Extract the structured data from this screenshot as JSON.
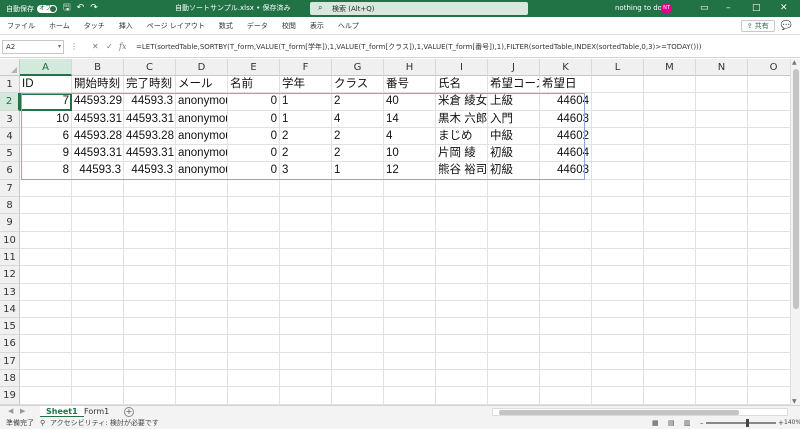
{
  "titlebar": {
    "autosave_label": "自動保存",
    "autosave_state": "オフ",
    "save_icon": "save-icon",
    "undo_icon": "undo-icon",
    "redo_icon": "redo-icon",
    "file_title": "自動ソートサンプル.xlsx • 保存済み",
    "search_placeholder": "検索 (Alt+Q)",
    "user_name": "nothing to do",
    "avatar_initials": "NT",
    "min": "–",
    "max": "□",
    "close": "✕"
  },
  "ribbon": {
    "tabs": [
      "ファイル",
      "ホーム",
      "タッチ",
      "挿入",
      "ページ レイアウト",
      "数式",
      "データ",
      "校閲",
      "表示",
      "ヘルプ"
    ],
    "share_label": "共有"
  },
  "formula_bar": {
    "name_box": "A2",
    "formula": "=LET(sortedTable,SORTBY(T_form,VALUE(T_form[学年]),1,VALUE(T_form[クラス]),1,VALUE(T_form[番号]),1),FILTER(sortedTable,INDEX(sortedTable,0,3)>=TODAY()))"
  },
  "grid": {
    "columns": [
      "A",
      "B",
      "C",
      "D",
      "E",
      "F",
      "G",
      "H",
      "I",
      "J",
      "K",
      "L",
      "M",
      "N",
      "O"
    ],
    "row_numbers": [
      "1",
      "2",
      "3",
      "4",
      "5",
      "6",
      "7",
      "8",
      "9",
      "10",
      "11",
      "12",
      "13",
      "14",
      "15",
      "16",
      "17",
      "18",
      "19"
    ],
    "header_row": [
      "ID",
      "開始時刻",
      "完了時刻",
      "メール",
      "名前",
      "学年",
      "クラス",
      "番号",
      "氏名",
      "希望コース",
      "希望日"
    ],
    "data_rows": [
      [
        "7",
        "44593.29",
        "44593.3",
        "anonymous",
        "0",
        "1",
        "2",
        "40",
        "米倉 綾女",
        "上級",
        "44604"
      ],
      [
        "10",
        "44593.31",
        "44593.31",
        "anonymous",
        "0",
        "1",
        "4",
        "14",
        "黒木 六郎",
        "入門",
        "44603"
      ],
      [
        "6",
        "44593.28",
        "44593.28",
        "anonymous",
        "0",
        "2",
        "2",
        "4",
        "まじめ",
        "中級",
        "44602"
      ],
      [
        "9",
        "44593.31",
        "44593.31",
        "anonymous",
        "0",
        "2",
        "2",
        "10",
        "片岡 綾",
        "初級",
        "44604"
      ],
      [
        "8",
        "44593.3",
        "44593.3",
        "anonymous",
        "0",
        "3",
        "1",
        "12",
        "熊谷 裕司",
        "初級",
        "44603"
      ]
    ]
  },
  "sheets": {
    "tabs": [
      "Sheet1",
      "Form1"
    ],
    "active": "Sheet1"
  },
  "statusbar": {
    "ready": "準備完了",
    "accessibility": "アクセシビリティ: 検討が必要です",
    "zoom": "140%"
  }
}
